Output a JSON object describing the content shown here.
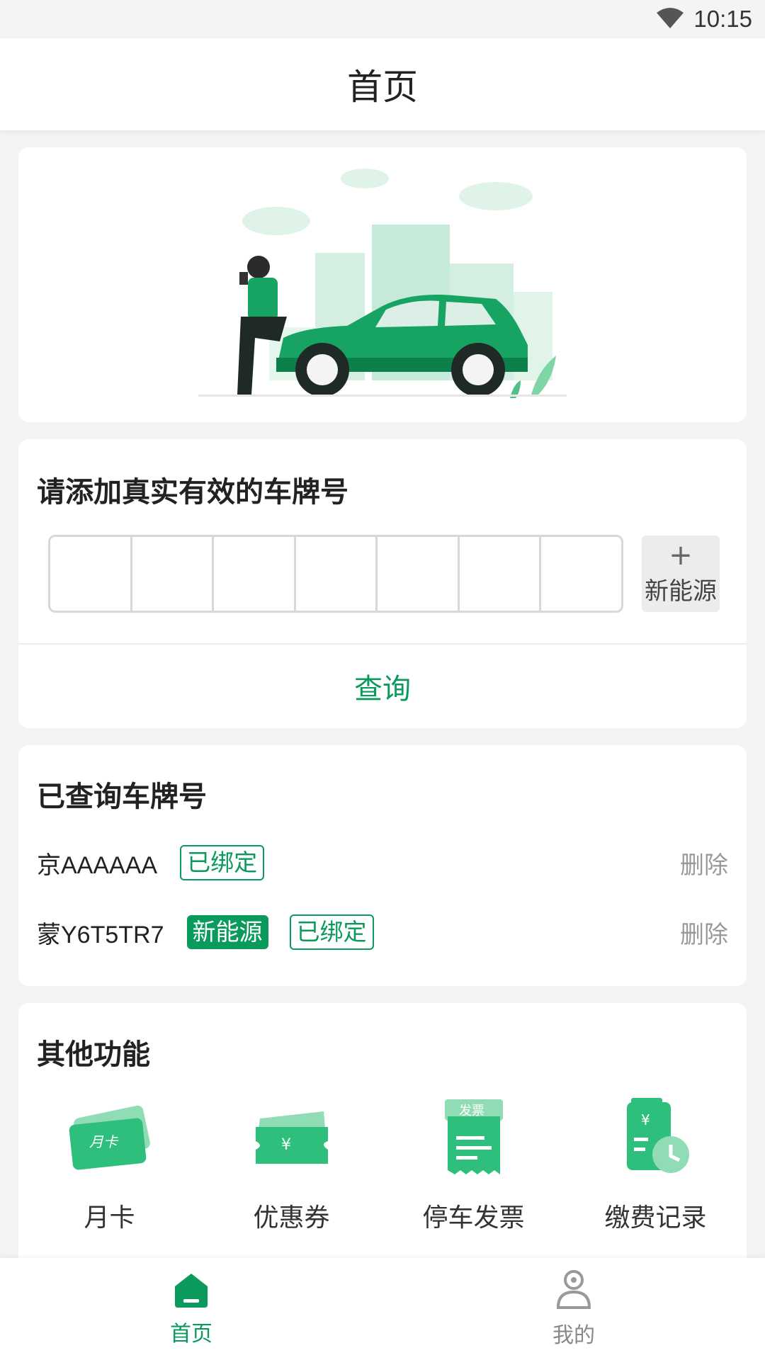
{
  "status_bar": {
    "time": "10:15",
    "icons": [
      "wifi-icon"
    ]
  },
  "nav": {
    "title": "首页"
  },
  "banner": {
    "illustration": "person-with-green-car-illustration"
  },
  "plate_input": {
    "title": "请添加真实有效的车牌号",
    "boxes": [
      "",
      "",
      "",
      "",
      "",
      "",
      ""
    ],
    "new_energy_label": "新能源",
    "query_label": "查询"
  },
  "history": {
    "title": "已查询车牌号",
    "rows": [
      {
        "plate": "京AAAAAA",
        "new_energy": "",
        "bound": "已绑定",
        "delete": "删除"
      },
      {
        "plate": "蒙Y6T5TR7",
        "new_energy": "新能源",
        "bound": "已绑定",
        "delete": "删除"
      }
    ]
  },
  "features": {
    "title": "其他功能",
    "items": [
      {
        "label": "月卡",
        "icon": "monthly-card-icon",
        "icon_text": "月卡"
      },
      {
        "label": "优惠券",
        "icon": "coupon-icon",
        "icon_text": "¥"
      },
      {
        "label": "停车发票",
        "icon": "invoice-icon",
        "icon_text": "发票"
      },
      {
        "label": "缴费记录",
        "icon": "payment-record-icon",
        "icon_text": "¥"
      }
    ]
  },
  "tabs": [
    {
      "label": "首页",
      "icon": "home-icon",
      "active": true
    },
    {
      "label": "我的",
      "icon": "user-icon",
      "active": false
    }
  ],
  "colors": {
    "accent": "#0a9a5c",
    "background": "#f2f3f5"
  }
}
